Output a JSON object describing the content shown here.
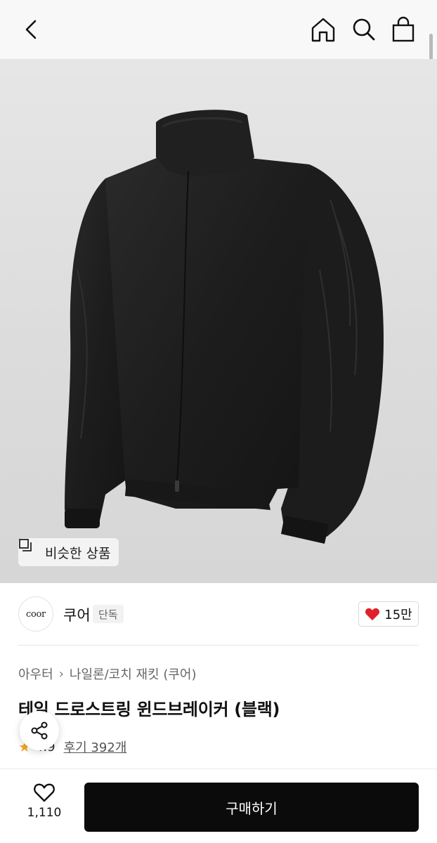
{
  "header": {
    "back_icon": "chevron-left-icon",
    "home_icon": "home-icon",
    "search_icon": "search-icon",
    "bag_icon": "shopping-bag-icon"
  },
  "hero": {
    "similar_button_label": "비슷한 상품",
    "similar_icon": "copy-squares-icon",
    "background": "#dddddd"
  },
  "brand": {
    "logo_text": "coor",
    "name": "쿠어",
    "badge": "단독",
    "like_count": "15만",
    "heart_color": "#e0202a"
  },
  "breadcrumb": {
    "category": "아우터",
    "subcategory": "나일론/코치 재킷 (쿠어)"
  },
  "product": {
    "title": "테일 드로스트링 윈드브레이커 (블랙)",
    "rating": "4.9",
    "review_label": "후기 392개"
  },
  "share_icon": "share-icon",
  "bottom": {
    "wish_count": "1,110",
    "buy_label": "구매하기"
  }
}
